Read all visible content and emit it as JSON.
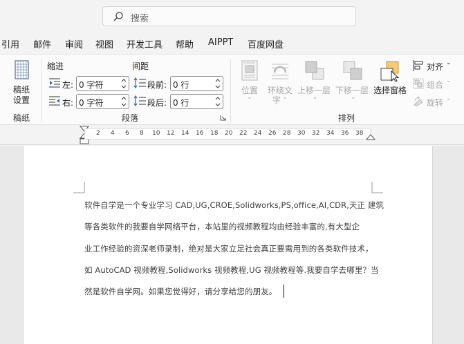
{
  "search": {
    "placeholder": "搜索"
  },
  "menu": {
    "items": [
      "引用",
      "邮件",
      "审阅",
      "视图",
      "开发工具",
      "帮助",
      "AIPPT",
      "百度网盘"
    ]
  },
  "ribbon": {
    "manuscript": {
      "button_line1": "稿纸",
      "button_line2": "设置",
      "group": "稿纸"
    },
    "paragraph": {
      "indent_heading": "缩进",
      "spacing_heading": "间距",
      "left_label": "左:",
      "right_label": "右:",
      "before_label": "段前:",
      "after_label": "段后:",
      "left_value": "0 字符",
      "right_value": "0 字符",
      "before_value": "0 行",
      "after_value": "0 行",
      "group": "段落"
    },
    "arrange": {
      "position": "位置",
      "wrap_line1": "环绕文",
      "wrap_line2": "字",
      "bring_forward": "上移一层",
      "send_backward": "下移一层",
      "selection_pane": "选择窗格",
      "align": "对齐",
      "group_cmd": "组合",
      "rotate": "旋转",
      "group": "排列"
    }
  },
  "ruler": {
    "ticks": [
      "2",
      "4",
      "6",
      "8",
      "10",
      "12",
      "14",
      "16",
      "18",
      "20",
      "22",
      "24",
      "26",
      "28",
      "30",
      "32",
      "34",
      "36",
      "38"
    ]
  },
  "document": {
    "lines": [
      "软件自学是一个专业学习 CAD,UG,CROE,Solidworks,PS,office,AI,CDR,天正  建筑",
      "等各类软件的我要自学网络平台，本站里的视频教程均由经验丰富的,有大型企",
      "业工作经验的资深老师录制，绝对是大家立足社会真正要需用到的各类软件技术，",
      "如 AutoCAD 视频教程,Solidworks 视频教程,UG 视频教程等.我要自学去哪里？当",
      "然是软件自学网。如果您觉得好，请分享给您的朋友。"
    ]
  },
  "colors": {
    "accent_yellow": "#f7c873",
    "disabled": "#a7a7a7"
  }
}
